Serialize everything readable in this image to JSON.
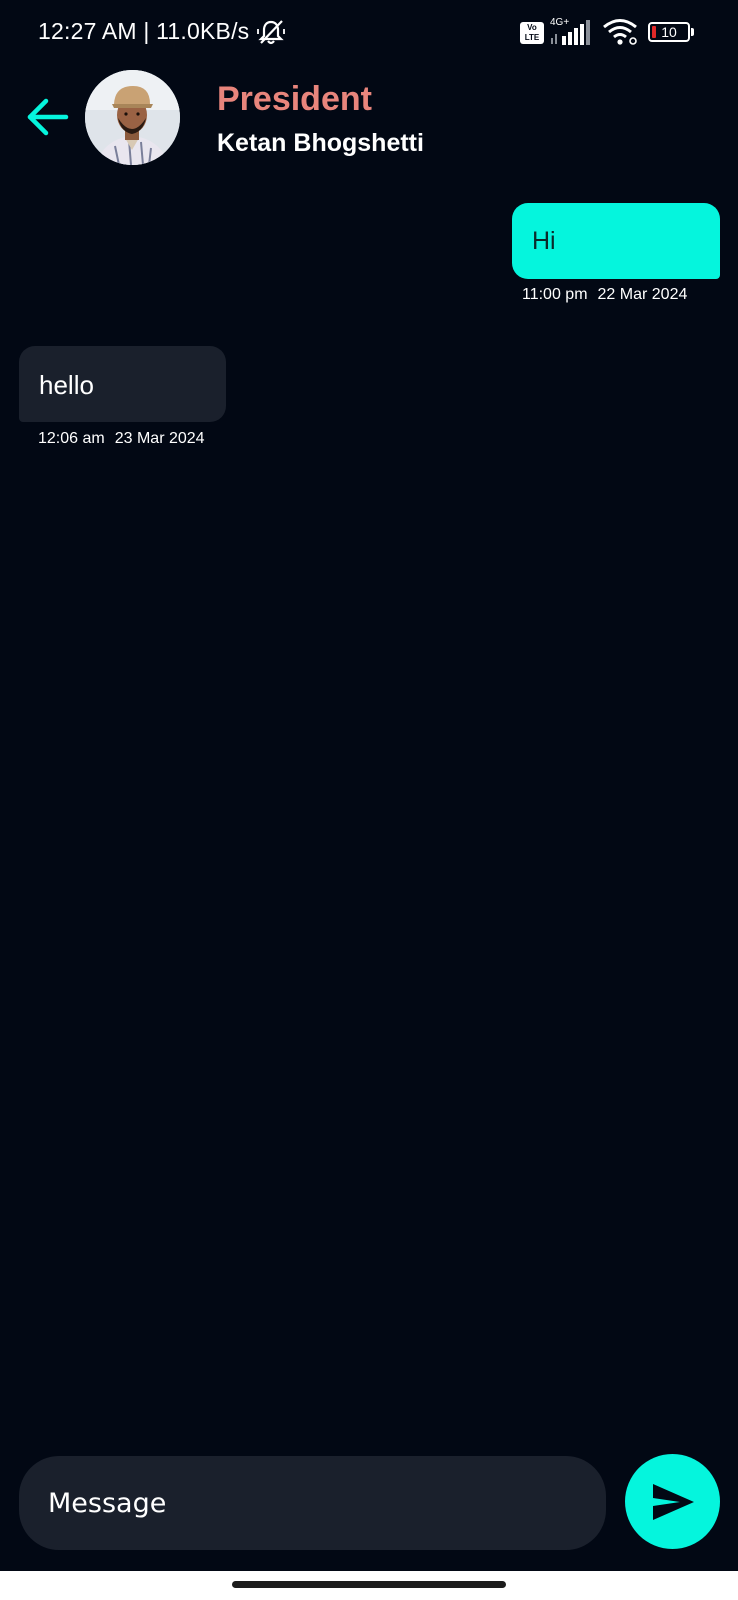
{
  "status_bar": {
    "time_speed": "12:27 AM | 11.0KB/s",
    "volte": "Vo LTE",
    "network_type": "4G+",
    "battery_level": "10",
    "icons": [
      "mute-icon",
      "signal-icon",
      "wifi-icon",
      "battery-icon"
    ]
  },
  "header": {
    "role": "President",
    "name": "Ketan Bhogshetti",
    "back_icon": "arrow-left-icon"
  },
  "messages": [
    {
      "direction": "outgoing",
      "text": "Hi",
      "time": "11:00 pm",
      "date": "22 Mar 2024"
    },
    {
      "direction": "incoming",
      "text": "hello",
      "time": "12:06 am",
      "date": "23 Mar 2024"
    }
  ],
  "composer": {
    "placeholder": "Message",
    "send_icon": "send-icon"
  },
  "colors": {
    "background": "#020814",
    "accent": "#05f5dd",
    "role": "#e8857c",
    "bubble_incoming": "#1a202c"
  }
}
